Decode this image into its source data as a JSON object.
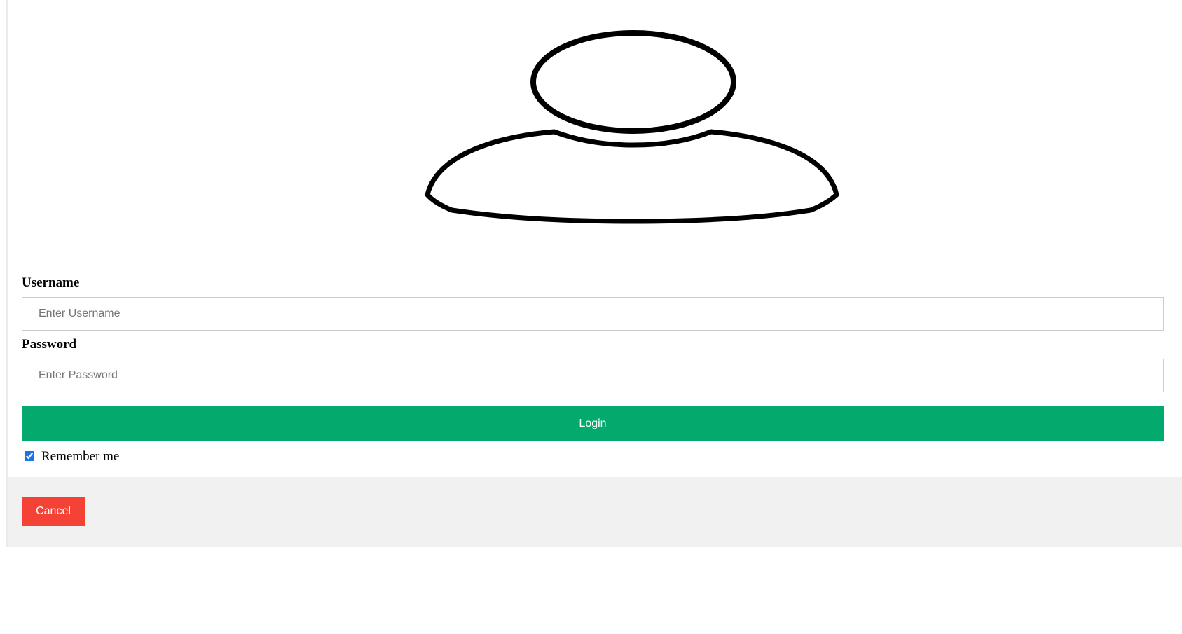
{
  "avatar": {
    "icon": "user-avatar-icon"
  },
  "form": {
    "username_label": "Username",
    "username_placeholder": "Enter Username",
    "username_value": "",
    "password_label": "Password",
    "password_placeholder": "Enter Password",
    "password_value": "",
    "login_label": "Login",
    "remember_label": "Remember me",
    "remember_checked": true
  },
  "footer": {
    "cancel_label": "Cancel"
  },
  "colors": {
    "login_button": "#04aa6d",
    "cancel_button": "#f44336",
    "footer_background": "#f1f1f1",
    "input_border": "#cccccc"
  }
}
